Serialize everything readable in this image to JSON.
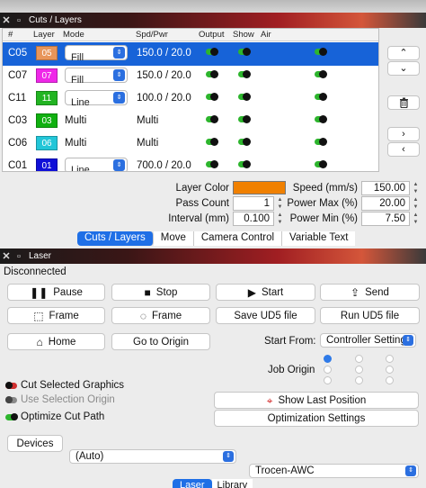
{
  "cuts_panel": {
    "title": "Cuts / Layers",
    "columns": [
      "#",
      "Layer",
      "Mode",
      "Spd/Pwr",
      "Output",
      "Show",
      "Air"
    ],
    "rows": [
      {
        "id": "C05",
        "layer": "05",
        "color": "#e8955a",
        "mode": "Fill",
        "mode_dropdown": true,
        "spdpwr": "150.0 / 20.0",
        "selected": true
      },
      {
        "id": "C07",
        "layer": "07",
        "color": "#ef27e8",
        "mode": "Fill",
        "mode_dropdown": true,
        "spdpwr": "150.0 / 20.0",
        "selected": false
      },
      {
        "id": "C11",
        "layer": "11",
        "color": "#22b422",
        "mode": "Line",
        "mode_dropdown": true,
        "spdpwr": "100.0 / 20.0",
        "selected": false
      },
      {
        "id": "C03",
        "layer": "03",
        "color": "#10b010",
        "mode": "Multi",
        "mode_dropdown": false,
        "spdpwr": "Multi",
        "selected": false
      },
      {
        "id": "C06",
        "layer": "06",
        "color": "#22c6d8",
        "mode": "Multi",
        "mode_dropdown": false,
        "spdpwr": "Multi",
        "selected": false
      },
      {
        "id": "C01",
        "layer": "01",
        "color": "#1010d8",
        "mode": "Line",
        "mode_dropdown": true,
        "spdpwr": "700.0 / 20.0",
        "selected": false
      }
    ],
    "side_buttons": {
      "up": "⌃",
      "down": "⌄",
      "delete": "trash-icon",
      "right": "›",
      "left": "‹"
    },
    "settings": {
      "layer_color_label": "Layer Color",
      "layer_color_value": "#f08000",
      "pass_count_label": "Pass Count",
      "pass_count_value": "1",
      "interval_label": "Interval (mm)",
      "interval_value": "0.100",
      "speed_label": "Speed (mm/s)",
      "speed_value": "150.00",
      "power_max_label": "Power Max (%)",
      "power_max_value": "20.00",
      "power_min_label": "Power Min (%)",
      "power_min_value": "7.50"
    },
    "tabs": [
      "Cuts / Layers",
      "Move",
      "Camera Control",
      "Variable Text"
    ],
    "active_tab": "Cuts / Layers"
  },
  "laser_panel": {
    "title": "Laser",
    "status": "Disconnected",
    "buttons": {
      "pause": "Pause",
      "stop": "Stop",
      "start": "Start",
      "send": "Send",
      "frame1": "Frame",
      "frame2": "Frame",
      "save_ud5": "Save UD5 file",
      "run_ud5": "Run UD5 file",
      "home": "Home",
      "go_origin": "Go to Origin",
      "show_last": "Show Last Position",
      "opt_settings": "Optimization Settings",
      "devices": "Devices"
    },
    "start_from_label": "Start From:",
    "start_from_value": "Controller Setting",
    "job_origin_label": "Job Origin",
    "options": {
      "cut_selected": "Cut Selected Graphics",
      "use_selection_origin": "Use Selection Origin",
      "optimize_cut_path": "Optimize Cut Path"
    },
    "port_value": "(Auto)",
    "device_value": "Trocen-AWC",
    "bottom_tabs": [
      "Laser",
      "Library"
    ]
  },
  "colors": {
    "selection": "#1763d8",
    "accent": "#2b6fe0",
    "toggle_on": "#2db52d",
    "toggle_off": "#d03030"
  }
}
